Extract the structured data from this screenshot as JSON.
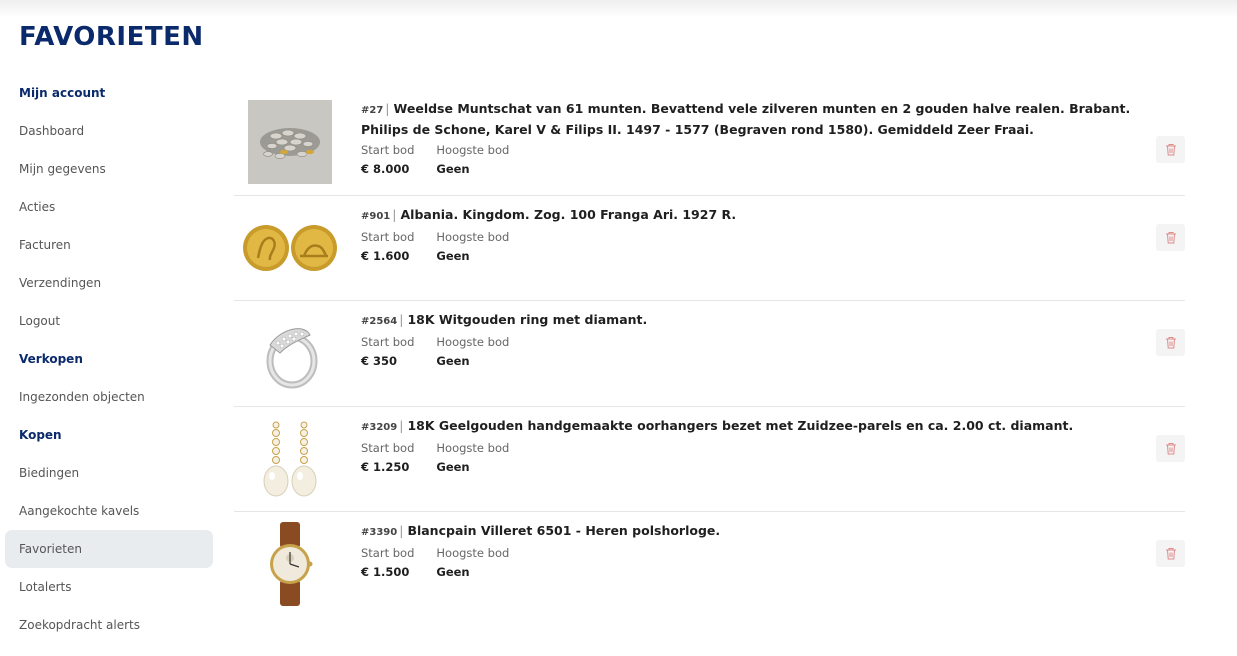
{
  "page": {
    "title": "FAVORIETEN"
  },
  "sidebar": {
    "sections": [
      {
        "heading": "Mijn account",
        "items": [
          "Dashboard",
          "Mijn gegevens",
          "Acties",
          "Facturen",
          "Verzendingen",
          "Logout"
        ]
      },
      {
        "heading": "Verkopen",
        "items": [
          "Ingezonden objecten"
        ]
      },
      {
        "heading": "Kopen",
        "items": [
          "Biedingen",
          "Aangekochte kavels",
          "Favorieten",
          "Lotalerts",
          "Zoekopdracht alerts"
        ]
      }
    ],
    "active": "Favorieten"
  },
  "labels": {
    "start_bid": "Start bod",
    "highest_bid": "Hoogste bod"
  },
  "favorites": [
    {
      "lot": "#27",
      "title": "Weeldse Muntschat van 61 munten. Bevattend vele zilveren munten en 2 gouden halve realen. Brabant. Philips de Schone, Karel V & Filips II. 1497 - 1577 (Begraven rond 1580). Gemiddeld Zeer Fraai.",
      "start_bid": "€ 8.000",
      "highest_bid": "Geen",
      "image": "coin-hoard-image"
    },
    {
      "lot": "#901",
      "title": "Albania. Kingdom. Zog. 100 Franga Ari. 1927 R.",
      "start_bid": "€ 1.600",
      "highest_bid": "Geen",
      "image": "gold-coin-image"
    },
    {
      "lot": "#2564",
      "title": "18K Witgouden ring met diamant.",
      "start_bid": "€ 350",
      "highest_bid": "Geen",
      "image": "ring-image"
    },
    {
      "lot": "#3209",
      "title": "18K Geelgouden handgemaakte oorhangers bezet met Zuidzee-parels en ca. 2.00 ct. diamant.",
      "start_bid": "€ 1.250",
      "highest_bid": "Geen",
      "image": "earrings-image"
    },
    {
      "lot": "#3390",
      "title": "Blancpain Villeret 6501 - Heren polshorloge.",
      "start_bid": "€ 1.500",
      "highest_bid": "Geen",
      "image": "watch-image"
    }
  ],
  "icons": {
    "delete": "trash-icon"
  },
  "colors": {
    "brand": "#0b2a6b",
    "active_bg": "#e9ecef",
    "delete_icon": "#e08a8a"
  }
}
